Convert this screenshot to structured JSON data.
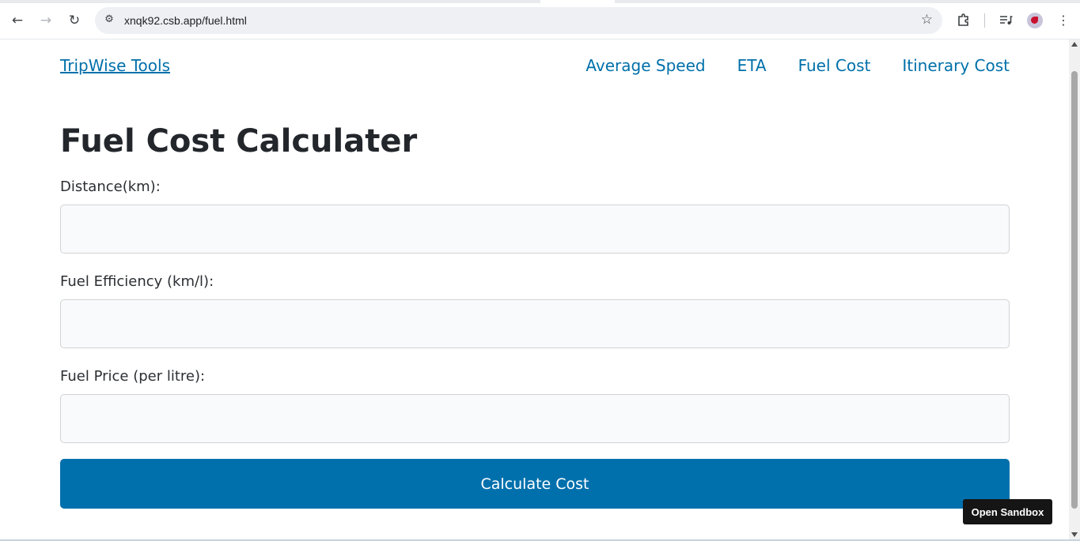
{
  "browser": {
    "url": "xnqk92.csb.app/fuel.html",
    "icons": {
      "back": "back-arrow-icon",
      "forward": "forward-arrow-icon",
      "reload": "reload-icon",
      "site_info": "site-settings-icon",
      "bookmark": "star-icon",
      "extensions": "puzzle-icon",
      "media": "media-queue-icon",
      "menu": "kebab-menu-icon"
    }
  },
  "header": {
    "logo": "TripWise Tools",
    "nav": [
      "Average Speed",
      "ETA",
      "Fuel Cost",
      "Itinerary Cost"
    ]
  },
  "main": {
    "title": "Fuel Cost Calculater",
    "fields": [
      {
        "label": "Distance(km):",
        "value": ""
      },
      {
        "label": "Fuel Efficiency (km/l):",
        "value": ""
      },
      {
        "label": "Fuel Price (per litre):",
        "value": ""
      }
    ],
    "button_label": "Calculate Cost"
  },
  "sandbox": {
    "button_label": "Open Sandbox"
  },
  "colors": {
    "accent": "#0070ad",
    "link": "#0070aa",
    "heading": "#23272c"
  }
}
